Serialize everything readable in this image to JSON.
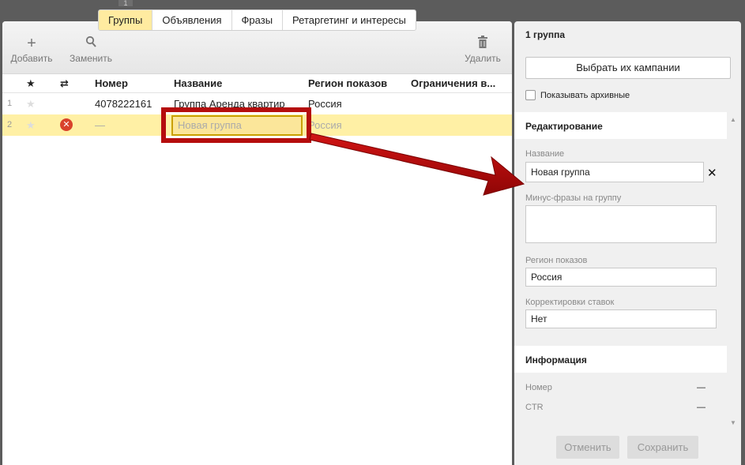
{
  "top_counter": "1",
  "tabs": [
    {
      "label": "Группы",
      "active": true
    },
    {
      "label": "Объявления",
      "active": false
    },
    {
      "label": "Фразы",
      "active": false
    },
    {
      "label": "Ретаргетинг и интересы",
      "active": false
    }
  ],
  "toolbar": {
    "add_label": "Добавить",
    "replace_label": "Заменить",
    "delete_label": "Удалить",
    "add_icon": "plus-icon",
    "replace_icon": "search-icon",
    "delete_icon": "trash-icon"
  },
  "table": {
    "headers": {
      "star": "★",
      "status": "⇄",
      "number": "Номер",
      "name": "Название",
      "region": "Регион показов",
      "limits": "Ограничения в..."
    },
    "rows": [
      {
        "index": "1",
        "number": "4078222161",
        "name": "Группа Аренда квартир",
        "region": "Россия"
      },
      {
        "index": "2",
        "number": "—",
        "name": "Новая группа",
        "region": "Россия",
        "error": true
      }
    ]
  },
  "side": {
    "title": "1 группа",
    "choose_button": "Выбрать их кампании",
    "show_archived": "Показывать архивные",
    "edit_section": "Редактирование",
    "name_label": "Название",
    "name_value": "Новая группа",
    "minus_label": "Минус-фразы на группу",
    "region_label": "Регион показов",
    "region_value": "Россия",
    "bid_label": "Корректировки ставок",
    "bid_value": "Нет",
    "info_section": "Информация",
    "info_number_label": "Номер",
    "info_number_value": "—",
    "info_ctr_label": "CTR",
    "info_ctr_value": "—",
    "cancel_button": "Отменить",
    "save_button": "Сохранить"
  },
  "colors": {
    "accent_tab": "#ffeba0",
    "row_highlight": "#fff0a5",
    "annotation_red": "#b50d0d",
    "error_red": "#d9432c"
  }
}
